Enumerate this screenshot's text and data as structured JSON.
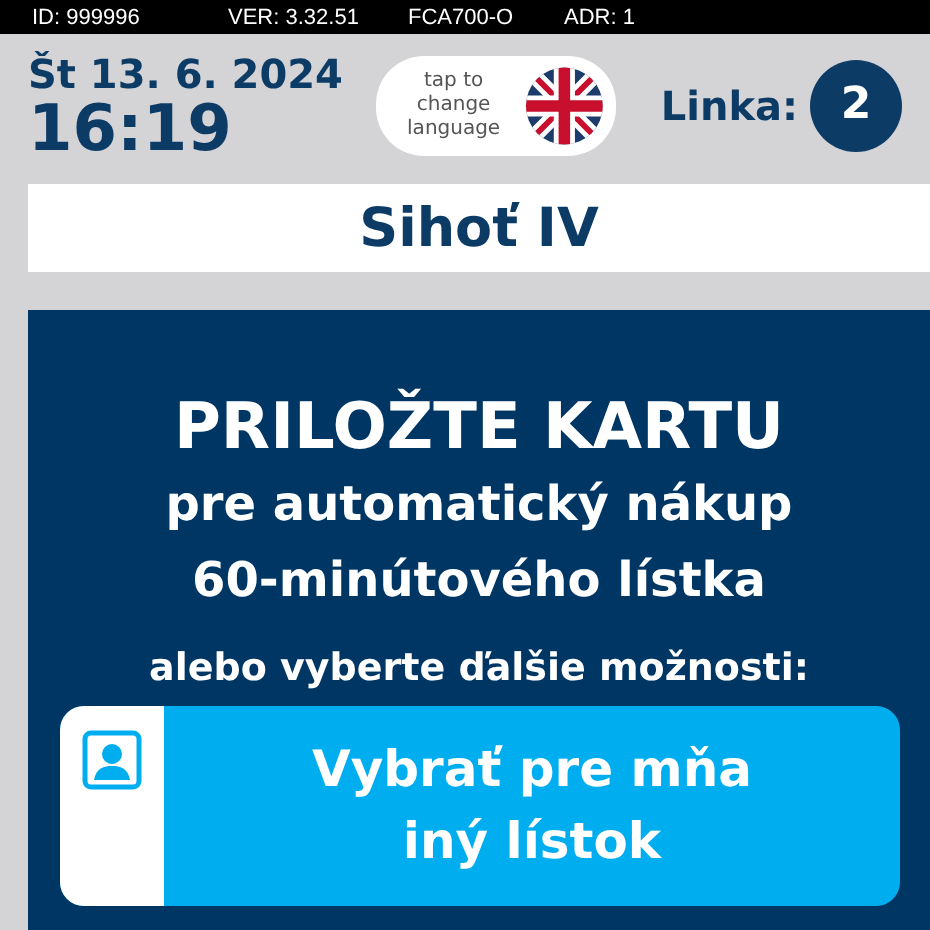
{
  "status_bar": {
    "id": "ID: 999996",
    "version": "VER: 3.32.51",
    "device": "FCA700-O",
    "address": "ADR: 1"
  },
  "header": {
    "date": "Št 13. 6. 2024",
    "time": "16:19",
    "language_button": "tap to change language",
    "line_label": "Linka:",
    "line_number": "2"
  },
  "stop_name": "Sihoť IV",
  "panel": {
    "title": "PRILOŽTE KARTU",
    "subtitle_1": "pre automatický nákup",
    "subtitle_2": "60-minútového lístka",
    "prompt": "alebo vyberte ďalšie možnosti:",
    "options": [
      {
        "kind": "person",
        "label": "Vybrať pre mňa iný lístok"
      }
    ]
  }
}
